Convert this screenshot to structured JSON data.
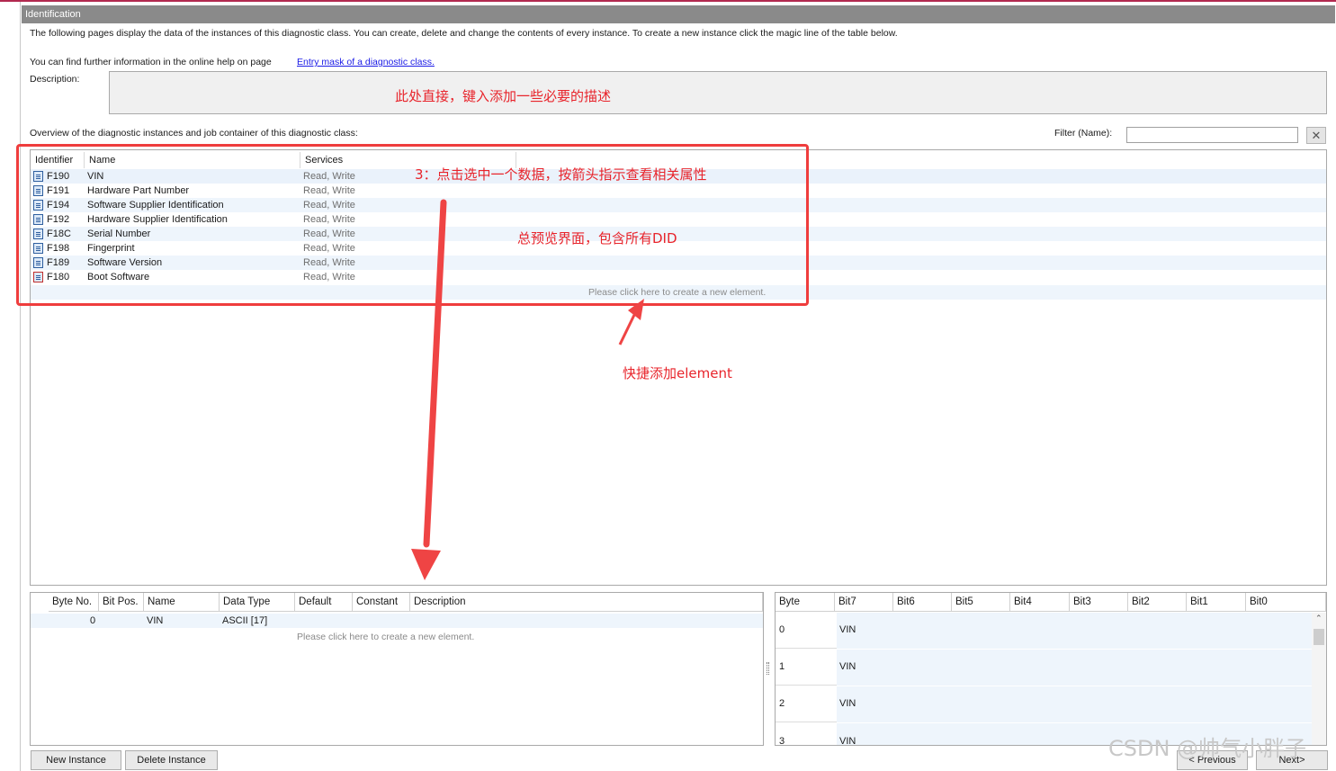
{
  "window": {
    "title": "Identification"
  },
  "intro_text": "The following pages display the data of the instances of this diagnostic class. You can create, delete and change the contents of every instance. To create a new instance click the magic line of the table below.",
  "help": {
    "text": "You can find further information in the online help on page",
    "link": "Entry mask of a diagnostic class."
  },
  "description": {
    "label": "Description:",
    "value": ""
  },
  "overview_label": "Overview of the diagnostic instances and job container of this diagnostic class:",
  "filter": {
    "label": "Filter (Name):",
    "value": "",
    "clear_icon": "close-icon"
  },
  "instances": {
    "headers": {
      "identifier": "Identifier",
      "name": "Name",
      "services": "Services"
    },
    "rows": [
      {
        "id": "F190",
        "name": "VIN",
        "services": "Read, Write",
        "icon": "document-icon"
      },
      {
        "id": "F191",
        "name": "Hardware Part Number",
        "services": "Read, Write",
        "icon": "document-icon"
      },
      {
        "id": "F194",
        "name": "Software Supplier Identification",
        "services": "Read, Write",
        "icon": "document-icon"
      },
      {
        "id": "F192",
        "name": "Hardware Supplier Identification",
        "services": "Read, Write",
        "icon": "document-icon"
      },
      {
        "id": "F18C",
        "name": "Serial Number",
        "services": "Read, Write",
        "icon": "document-icon"
      },
      {
        "id": "F198",
        "name": "Fingerprint",
        "services": "Read, Write",
        "icon": "document-icon"
      },
      {
        "id": "F189",
        "name": "Software Version",
        "services": "Read, Write",
        "icon": "document-icon"
      },
      {
        "id": "F180",
        "name": "Boot Software",
        "services": "Read, Write",
        "icon": "document-edit-icon"
      }
    ],
    "magic_line": "Please click here to create a new element."
  },
  "params": {
    "headers": {
      "byte_no": "Byte No.",
      "bit_pos": "Bit Pos.",
      "name": "Name",
      "data_type": "Data Type",
      "default": "Default",
      "constant": "Constant",
      "description": "Description"
    },
    "rows": [
      {
        "byte_no": "0",
        "bit_pos": "",
        "name": "VIN",
        "data_type": "ASCII [17]",
        "default": "",
        "constant": "",
        "description": ""
      }
    ],
    "magic_line": "Please click here to create a new element."
  },
  "bitmap": {
    "headers": {
      "byte": "Byte",
      "bit7": "Bit7",
      "bit6": "Bit6",
      "bit5": "Bit5",
      "bit4": "Bit4",
      "bit3": "Bit3",
      "bit2": "Bit2",
      "bit1": "Bit1",
      "bit0": "Bit0"
    },
    "rows": [
      {
        "byte": "0",
        "value": "VIN"
      },
      {
        "byte": "1",
        "value": "VIN"
      },
      {
        "byte": "2",
        "value": "VIN"
      },
      {
        "byte": "3",
        "value": "VIN"
      }
    ],
    "scroll_icon": "chevron-up-icon"
  },
  "buttons": {
    "new_instance": "New Instance",
    "delete_instance": "Delete Instance",
    "previous": "< Previous",
    "next": "Next>"
  },
  "annotations": {
    "description_hint": "此处直接，键入添加一些必要的描述",
    "select_hint": "3：点击选中一个数据，按箭头指示查看相关属性",
    "overview_hint": "总预览界面，包含所有DID",
    "add_hint": "快捷添加element",
    "color": "#e8242b"
  },
  "watermark": "CSDN @帅气小胖子"
}
